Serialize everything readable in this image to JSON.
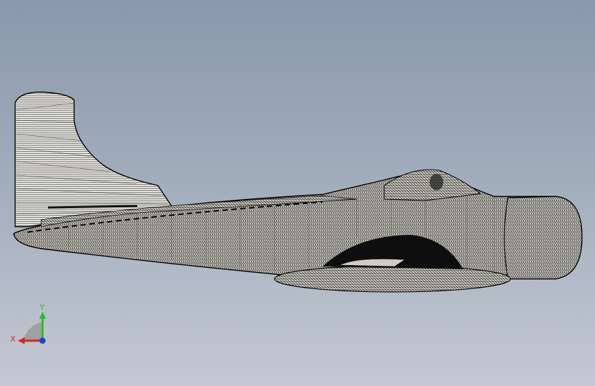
{
  "viewport": {
    "name": "3d-graphics-viewport",
    "background_top": "#8a98ab",
    "background_bottom": "#c3c9d3"
  },
  "model": {
    "description_icon": "aircraft-wireframe-mesh",
    "fill_color": "#d8d7cf",
    "mesh_color": "#000000"
  },
  "triad": {
    "x_label": "X",
    "y_label": "Y",
    "x_color": "#e02020",
    "y_color": "#22c022",
    "z_color": "#1f3fd8"
  }
}
